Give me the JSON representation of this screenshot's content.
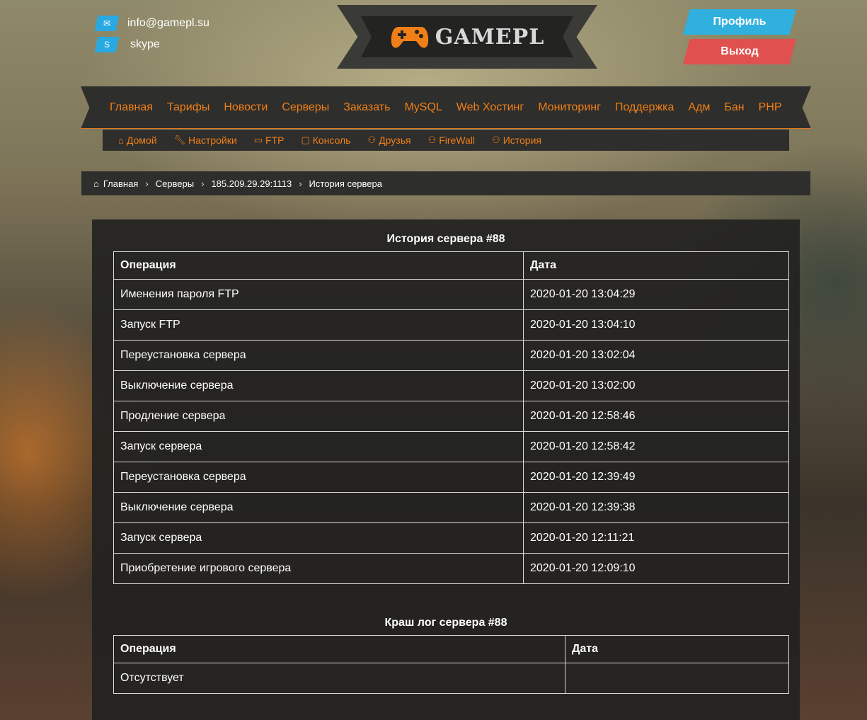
{
  "contacts": {
    "email": "info@gamepl.su",
    "skype": "skype"
  },
  "logo": {
    "text": "GAMEPL"
  },
  "top_buttons": {
    "profile": "Профиль",
    "logout": "Выход"
  },
  "main_nav": [
    "Главная",
    "Тарифы",
    "Новости",
    "Серверы",
    "Заказать",
    "MySQL",
    "Web Хостинг",
    "Мониторинг",
    "Поддержка",
    "Адм",
    "Бан",
    "PHP"
  ],
  "sub_nav": [
    {
      "label": "Домой",
      "icon": "home-icon"
    },
    {
      "label": "Настройки",
      "icon": "wrench-icon"
    },
    {
      "label": "FTP",
      "icon": "folder-icon"
    },
    {
      "label": "Консоль",
      "icon": "monitor-icon"
    },
    {
      "label": "Друзья",
      "icon": "users-icon"
    },
    {
      "label": "FireWall",
      "icon": "users-icon"
    },
    {
      "label": "История",
      "icon": "users-icon"
    }
  ],
  "breadcrumb": [
    "Главная",
    "Серверы",
    "185.209.29.29:1113",
    "История сервера"
  ],
  "history": {
    "title": "История сервера #88",
    "headers": {
      "operation": "Операция",
      "date": "Дата"
    },
    "rows": [
      [
        "Именения пароля FTP",
        "2020-01-20 13:04:29"
      ],
      [
        "Запуск FTP",
        "2020-01-20 13:04:10"
      ],
      [
        "Переустановка сервера",
        "2020-01-20 13:02:04"
      ],
      [
        "Выключение сервера",
        "2020-01-20 13:02:00"
      ],
      [
        "Продление сервера",
        "2020-01-20 12:58:46"
      ],
      [
        "Запуск сервера",
        "2020-01-20 12:58:42"
      ],
      [
        "Переустановка сервера",
        "2020-01-20 12:39:49"
      ],
      [
        "Выключение сервера",
        "2020-01-20 12:39:38"
      ],
      [
        "Запуск сервера",
        "2020-01-20 12:11:21"
      ],
      [
        "Приобретение игрового сервера",
        "2020-01-20 12:09:10"
      ]
    ]
  },
  "crash": {
    "title": "Краш лог сервера #88",
    "headers": {
      "operation": "Операция",
      "date": "Дата"
    },
    "rows": [
      [
        "Отсутствует",
        ""
      ]
    ]
  },
  "colors": {
    "accent": "#f07f17",
    "profile": "#2fb0df",
    "logout": "#e0504f",
    "panel": "#222221"
  }
}
